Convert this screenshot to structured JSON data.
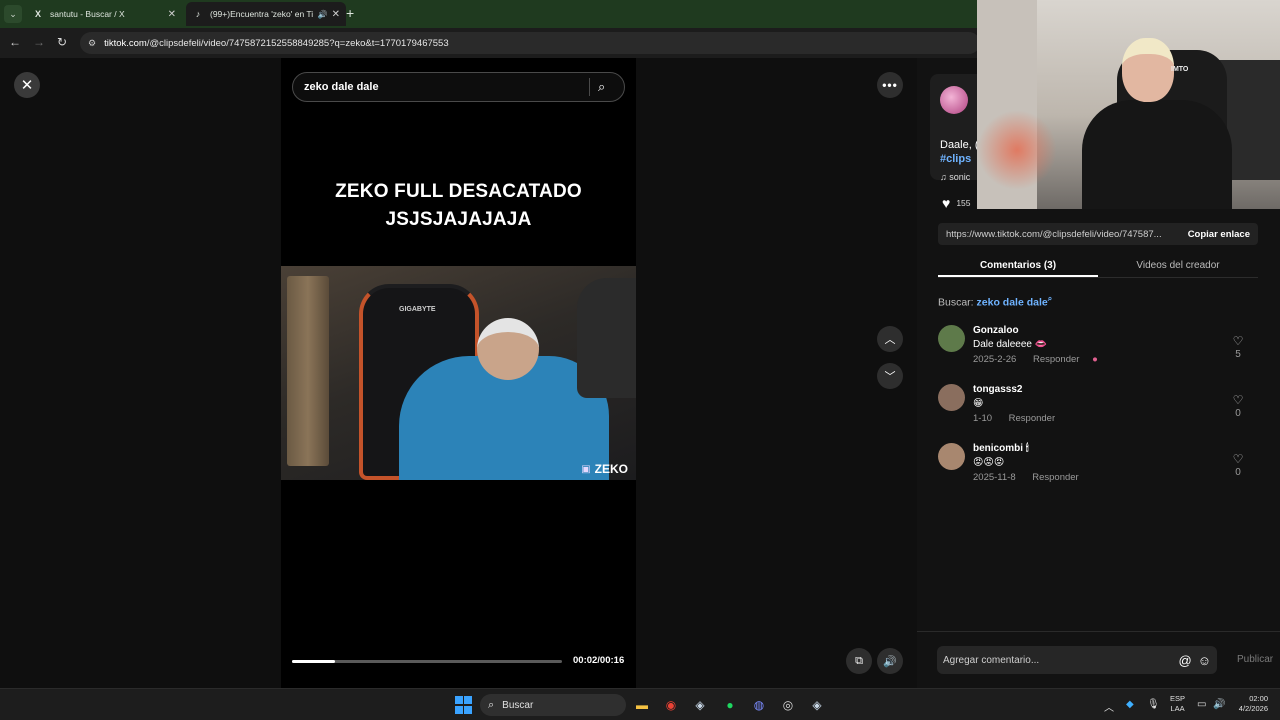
{
  "browser": {
    "tabs": [
      {
        "favicon": "X",
        "title": "santutu - Buscar / X"
      },
      {
        "favicon": "♪",
        "title": "(99+)Encuentra 'zeko' en Ti"
      }
    ],
    "url_domain": "tiktok.com",
    "url_path": "/@clipsdefeli/video/7475872152558849285?q=zeko&t=1770179467553"
  },
  "video": {
    "search_query": "zeko dale dale",
    "caption_line1": "ZEKO FULL DESACATADO",
    "caption_line2": "JSJSJAJAJAJA",
    "frame_brand": "ZEKO",
    "chair_brand": "GIGABYTE",
    "progress": 0.16,
    "time": "00:02/00:16"
  },
  "panel": {
    "description": "Daale, (",
    "hashtag": "#clips",
    "music": "sonic",
    "like_count": "155",
    "link": "https://www.tiktok.com/@clipsdefeli/video/747587...",
    "copy_link_label": "Copiar enlace",
    "tabs": [
      "Comentarios (3)",
      "Videos del creador"
    ],
    "search_label": "Buscar:",
    "search_term": "zeko dale dale",
    "comments": [
      {
        "user": "Gonzaloo",
        "text": "Dale daleeee 👄",
        "date": "2025-2-26",
        "reply": "Responder",
        "likes": "5",
        "avatar_color": "#5e7a4a"
      },
      {
        "user": "tongasss2",
        "text": "😁",
        "date": "1-10",
        "reply": "Responder",
        "likes": "0",
        "avatar_color": "#8a6e5e"
      },
      {
        "user": "benicombi 🕯",
        "text": "😡😡😡",
        "date": "2025-11-8",
        "reply": "Responder",
        "likes": "0",
        "avatar_color": "#a8876f"
      }
    ],
    "composer_placeholder": "Agregar comentario...",
    "publish_label": "Publicar"
  },
  "webcam": {
    "shirt_text": "IMTO"
  },
  "taskbar": {
    "search_label": "Buscar",
    "lang_line1": "ESP",
    "lang_line2": "LAA",
    "time": "02:00",
    "date": "4/2/2026"
  },
  "colors": {
    "link": "#6fb3ff",
    "tab_strip": "#1f3a1f"
  }
}
